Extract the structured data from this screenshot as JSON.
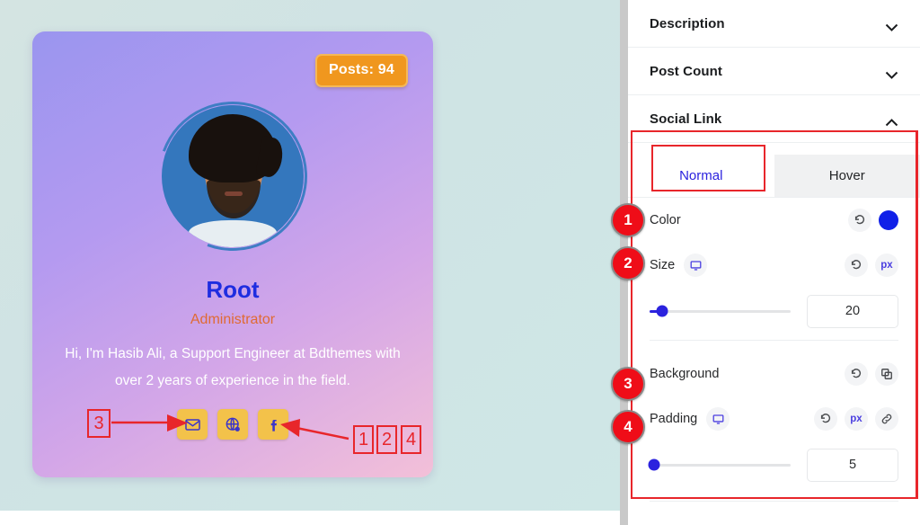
{
  "preview": {
    "card": {
      "posts_badge": "Posts: 94",
      "name": "Root",
      "role": "Administrator",
      "bio": "Hi, I'm Hasib Ali, a Support Engineer at Bdthemes with over 2 years of experience in the field.",
      "social_links": [
        {
          "icon": "email-icon",
          "label": "Email"
        },
        {
          "icon": "globe-icon",
          "label": "Website"
        },
        {
          "icon": "facebook-icon",
          "label": "Facebook"
        }
      ],
      "colors": {
        "name": "#1f2de0",
        "role": "#e06a33",
        "bio": "#ffffff",
        "badge_bg": "#f0971e",
        "social_bg": "#f3c24a",
        "social_icon": "#3b35c9"
      }
    },
    "annotations": {
      "marker_a": "3",
      "marker_b": "1",
      "marker_c": "2",
      "marker_d": "4",
      "color": "#e8262b"
    }
  },
  "panel": {
    "accordions": [
      {
        "title": "Description",
        "state": "collapsed",
        "chevron": "chevron-down-icon"
      },
      {
        "title": "Post Count",
        "state": "collapsed",
        "chevron": "chevron-down-icon"
      },
      {
        "title": "Social Link",
        "state": "expanded",
        "chevron": "chevron-up-icon"
      }
    ],
    "tabs": [
      {
        "label": "Normal",
        "active": true
      },
      {
        "label": "Hover",
        "active": false
      }
    ],
    "controls": [
      {
        "label": "Color",
        "badge": "1",
        "reset_icon": "reset-icon",
        "swatch_color": "#1020e8"
      },
      {
        "label": "Size",
        "badge": "2",
        "device_icon": "desktop-icon",
        "reset_icon": "reset-icon",
        "unit": "px",
        "slider_value": "20",
        "slider_percent": 9
      },
      {
        "label": "Background",
        "badge": "3",
        "reset_icon": "reset-icon",
        "copy_icon": "copy-icon"
      },
      {
        "label": "Padding",
        "badge": "4",
        "device_icon": "desktop-icon",
        "reset_icon": "reset-icon",
        "unit": "px",
        "link_icon": "link-icon",
        "slider_value": "5",
        "slider_percent": 3
      }
    ],
    "colors": {
      "accent": "#2b22de",
      "badge": "#ef0d18",
      "highlight": "#e8262b"
    }
  }
}
